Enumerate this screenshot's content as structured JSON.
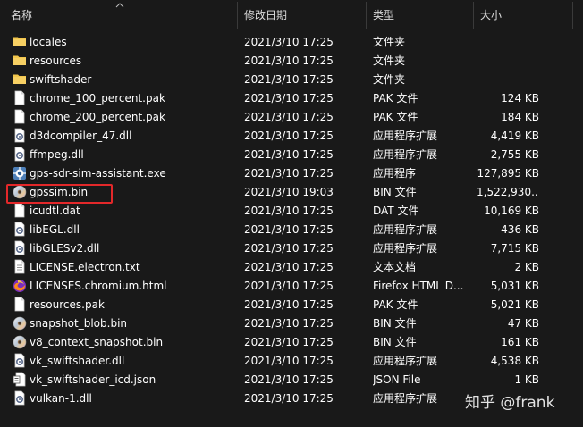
{
  "columns": {
    "name": "名称",
    "date": "修改日期",
    "type": "类型",
    "size": "大小"
  },
  "files": [
    {
      "name": "locales",
      "date": "2021/3/10 17:25",
      "type": "文件夹",
      "size": "",
      "icon": "folder-icon"
    },
    {
      "name": "resources",
      "date": "2021/3/10 17:25",
      "type": "文件夹",
      "size": "",
      "icon": "folder-icon"
    },
    {
      "name": "swiftshader",
      "date": "2021/3/10 17:25",
      "type": "文件夹",
      "size": "",
      "icon": "folder-icon"
    },
    {
      "name": "chrome_100_percent.pak",
      "date": "2021/3/10 17:25",
      "type": "PAK 文件",
      "size": "124 KB",
      "icon": "file-icon"
    },
    {
      "name": "chrome_200_percent.pak",
      "date": "2021/3/10 17:25",
      "type": "PAK 文件",
      "size": "184 KB",
      "icon": "file-icon"
    },
    {
      "name": "d3dcompiler_47.dll",
      "date": "2021/3/10 17:25",
      "type": "应用程序扩展",
      "size": "4,419 KB",
      "icon": "dll-icon"
    },
    {
      "name": "ffmpeg.dll",
      "date": "2021/3/10 17:25",
      "type": "应用程序扩展",
      "size": "2,755 KB",
      "icon": "dll-icon"
    },
    {
      "name": "gps-sdr-sim-assistant.exe",
      "date": "2021/3/10 17:25",
      "type": "应用程序",
      "size": "127,895 KB",
      "icon": "exe-icon"
    },
    {
      "name": "gpssim.bin",
      "date": "2021/3/10 19:03",
      "type": "BIN 文件",
      "size": "1,522,930...",
      "icon": "disc-icon"
    },
    {
      "name": "icudtl.dat",
      "date": "2021/3/10 17:25",
      "type": "DAT 文件",
      "size": "10,169 KB",
      "icon": "file-icon"
    },
    {
      "name": "libEGL.dll",
      "date": "2021/3/10 17:25",
      "type": "应用程序扩展",
      "size": "436 KB",
      "icon": "dll-icon"
    },
    {
      "name": "libGLESv2.dll",
      "date": "2021/3/10 17:25",
      "type": "应用程序扩展",
      "size": "7,715 KB",
      "icon": "dll-icon"
    },
    {
      "name": "LICENSE.electron.txt",
      "date": "2021/3/10 17:25",
      "type": "文本文档",
      "size": "2 KB",
      "icon": "text-file-icon"
    },
    {
      "name": "LICENSES.chromium.html",
      "date": "2021/3/10 17:25",
      "type": "Firefox HTML D...",
      "size": "5,031 KB",
      "icon": "firefox-icon"
    },
    {
      "name": "resources.pak",
      "date": "2021/3/10 17:25",
      "type": "PAK 文件",
      "size": "5,021 KB",
      "icon": "file-icon"
    },
    {
      "name": "snapshot_blob.bin",
      "date": "2021/3/10 17:25",
      "type": "BIN 文件",
      "size": "47 KB",
      "icon": "disc-icon"
    },
    {
      "name": "v8_context_snapshot.bin",
      "date": "2021/3/10 17:25",
      "type": "BIN 文件",
      "size": "161 KB",
      "icon": "disc-icon"
    },
    {
      "name": "vk_swiftshader.dll",
      "date": "2021/3/10 17:25",
      "type": "应用程序扩展",
      "size": "4,538 KB",
      "icon": "dll-icon"
    },
    {
      "name": "vk_swiftshader_icd.json",
      "date": "2021/3/10 17:25",
      "type": "JSON File",
      "size": "1 KB",
      "icon": "json-file-icon"
    },
    {
      "name": "vulkan-1.dll",
      "date": "2021/3/10 17:25",
      "type": "应用程序扩展",
      "size": "",
      "icon": "dll-icon"
    }
  ],
  "watermark": "知乎 @frank",
  "colors": {
    "background": "#191919",
    "folder": "#f3c64b",
    "highlight_border": "#e3282a"
  }
}
